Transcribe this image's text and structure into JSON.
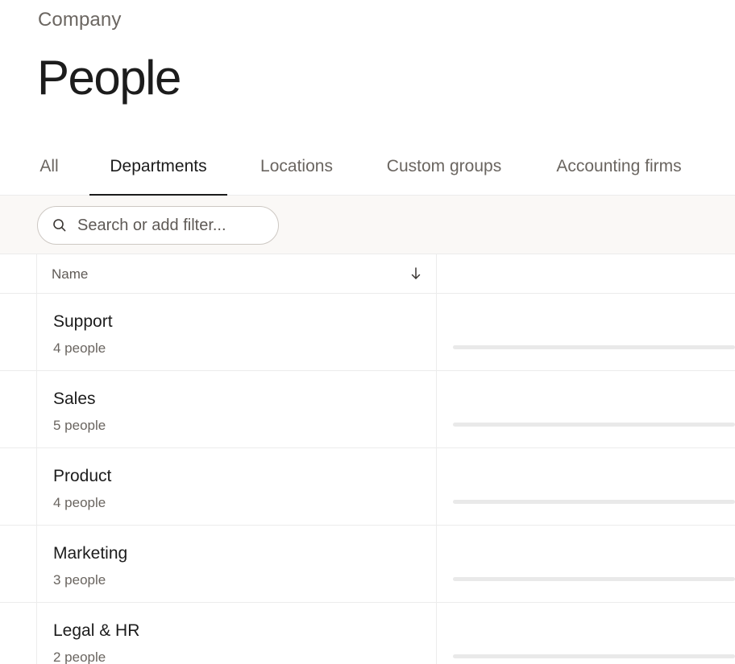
{
  "header": {
    "breadcrumb": "Company",
    "title": "People"
  },
  "tabs": [
    {
      "label": "All",
      "active": false
    },
    {
      "label": "Departments",
      "active": true
    },
    {
      "label": "Locations",
      "active": false
    },
    {
      "label": "Custom groups",
      "active": false
    },
    {
      "label": "Accounting firms",
      "active": false
    }
  ],
  "filter": {
    "placeholder": "Search or add filter..."
  },
  "table": {
    "columns": {
      "name": "Name"
    },
    "rows": [
      {
        "name": "Support",
        "count": "4 people"
      },
      {
        "name": "Sales",
        "count": "5 people"
      },
      {
        "name": "Product",
        "count": "4 people"
      },
      {
        "name": "Marketing",
        "count": "3 people"
      },
      {
        "name": "Legal & HR",
        "count": "2 people"
      }
    ]
  },
  "icons": {
    "search": "search-icon",
    "sort": "arrow-down-icon"
  }
}
